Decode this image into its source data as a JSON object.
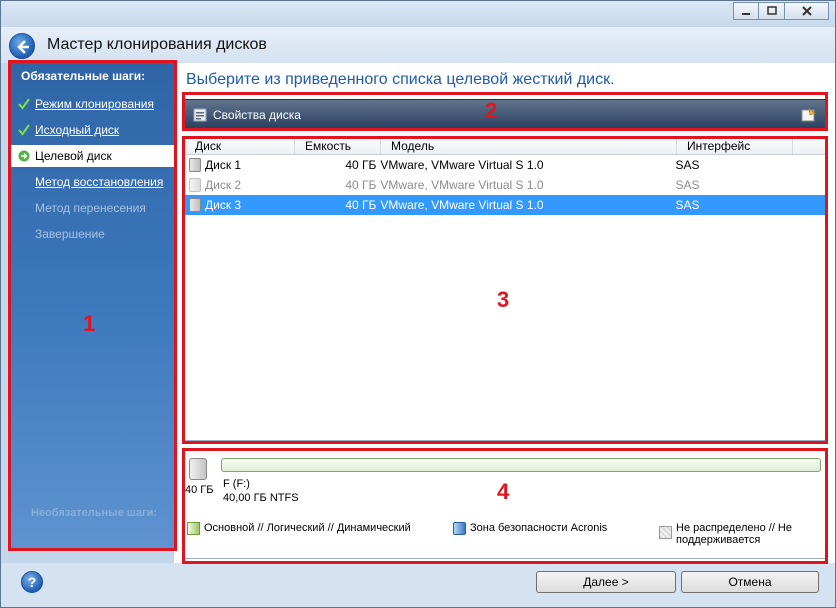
{
  "window": {
    "title": "Мастер клонирования дисков"
  },
  "sidebar": {
    "heading": "Обязательные шаги:",
    "items": [
      {
        "label": "Режим клонирования",
        "state": "done"
      },
      {
        "label": "Исходный диск",
        "state": "done"
      },
      {
        "label": "Целевой диск",
        "state": "active"
      },
      {
        "label": "Метод восстановления",
        "state": "link"
      },
      {
        "label": "Метод перенесения",
        "state": "disabled"
      },
      {
        "label": "Завершение",
        "state": "disabled"
      }
    ],
    "optional_heading": "Необязательные шаги:"
  },
  "main": {
    "instruction": "Выберите из приведенного списка целевой жесткий диск.",
    "toolbar": {
      "properties_label": "Свойства диска"
    },
    "table": {
      "columns": [
        "Диск",
        "Емкость",
        "Модель",
        "Интерфейс"
      ],
      "rows": [
        {
          "disk": "Диск 1",
          "capacity": "40 ГБ",
          "model": "VMware, VMware Virtual S 1.0",
          "interface": "SAS",
          "state": "normal"
        },
        {
          "disk": "Диск 2",
          "capacity": "40 ГБ",
          "model": "VMware, VMware Virtual S 1.0",
          "interface": "SAS",
          "state": "disabled"
        },
        {
          "disk": "Диск 3",
          "capacity": "40 ГБ",
          "model": "VMware, VMware Virtual S 1.0",
          "interface": "SAS",
          "state": "selected"
        }
      ]
    },
    "disk_map": {
      "disk_size": "40 ГБ",
      "partition_name": "F (F:)",
      "partition_info": "40,00 ГБ  NTFS",
      "legend": {
        "primary": "Основной // Логический // Динамический",
        "acronis": "Зона безопасности Acronis",
        "unallocated": "Не распределено // Не поддерживается"
      }
    }
  },
  "annotations": {
    "labels": [
      "1",
      "2",
      "3",
      "4"
    ],
    "color": "#e0141e"
  },
  "footer": {
    "help_label": "?",
    "next_label": "Далее >",
    "cancel_label": "Отмена"
  },
  "colors": {
    "accent": "#1f5bab",
    "selection": "#3399ff",
    "sidebar": "#3d78bd"
  }
}
